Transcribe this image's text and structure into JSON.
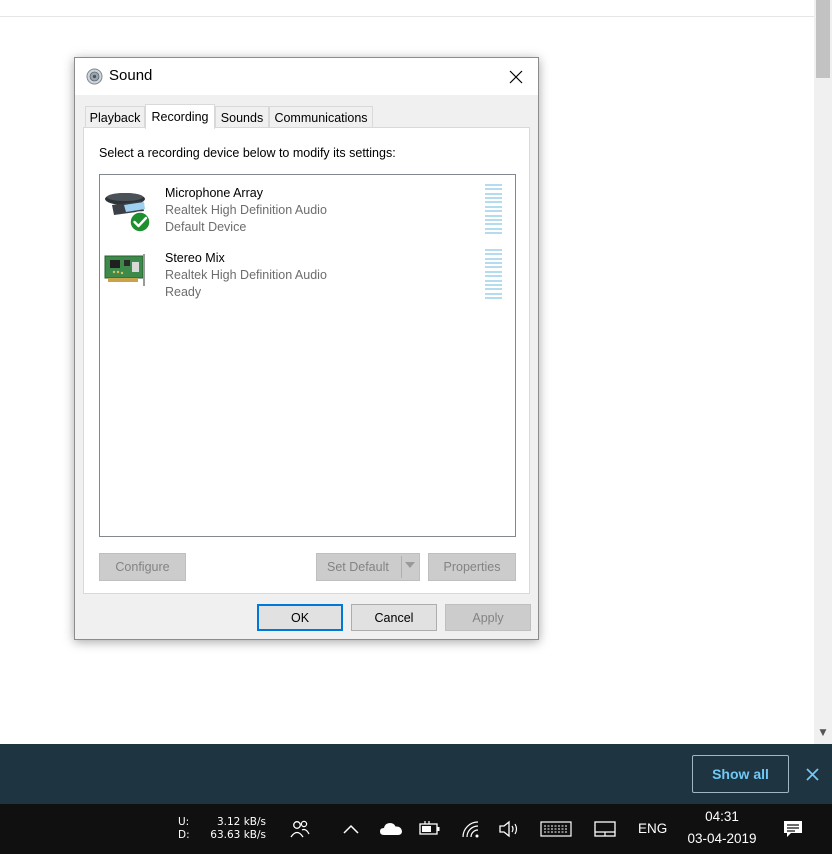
{
  "dialog": {
    "title": "Sound",
    "tabs": [
      {
        "label": "Playback",
        "active": false
      },
      {
        "label": "Recording",
        "active": true
      },
      {
        "label": "Sounds",
        "active": false
      },
      {
        "label": "Communications",
        "active": false
      }
    ],
    "instruction": "Select a recording device below to modify its settings:",
    "devices": [
      {
        "name": "Microphone Array",
        "driver": "Realtek High Definition Audio",
        "status": "Default Device",
        "icon": "microphone-array-icon",
        "is_default": true
      },
      {
        "name": "Stereo Mix",
        "driver": "Realtek High Definition Audio",
        "status": "Ready",
        "icon": "sound-card-icon",
        "is_default": false
      }
    ],
    "buttons": {
      "configure": "Configure",
      "set_default": "Set Default",
      "properties": "Properties",
      "ok": "OK",
      "cancel": "Cancel",
      "apply": "Apply"
    }
  },
  "notification_bar": {
    "show_all_label": "Show all"
  },
  "taskbar": {
    "upload_label": "U:",
    "download_label": "D:",
    "upload_speed": "3.12 kB/s",
    "download_speed": "63.63 kB/s",
    "language": "ENG",
    "time": "04:31",
    "date": "03-04-2019",
    "tray_icons": [
      "people-icon",
      "chevron-up-icon",
      "onedrive-cloud-icon",
      "battery-icon",
      "wifi-icon",
      "volume-icon",
      "keyboard-icon",
      "tablet-icon",
      "notification-icon"
    ]
  },
  "colors": {
    "accent": "#0078d7",
    "notify_bar": "#1e3441",
    "taskbar": "#101010",
    "show_all_text": "#6fc8f5"
  }
}
